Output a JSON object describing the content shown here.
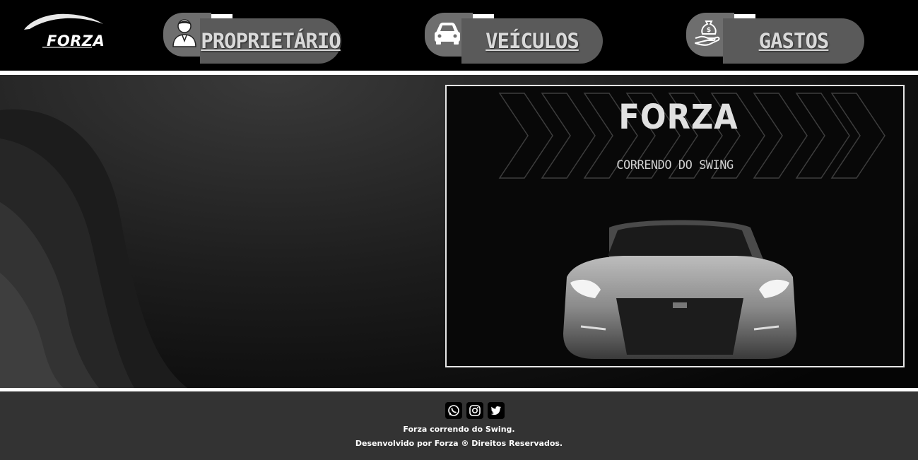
{
  "brand": {
    "logo_text": "FORZA"
  },
  "nav": [
    {
      "label": "PROPRIETÁRIO",
      "icon": "owner-icon"
    },
    {
      "label": "VEÍCULOS",
      "icon": "car-icon"
    },
    {
      "label": "GASTOS",
      "icon": "money-hand-icon"
    }
  ],
  "banner": {
    "title": "FORZA",
    "subtitle": "CORRENDO DO SWING"
  },
  "footer": {
    "social": [
      "whatsapp-icon",
      "instagram-icon",
      "twitter-icon"
    ],
    "line1": "Forza correndo do Swing.",
    "line2": "Desenvolvido por Forza ® Direitos Reservados."
  }
}
